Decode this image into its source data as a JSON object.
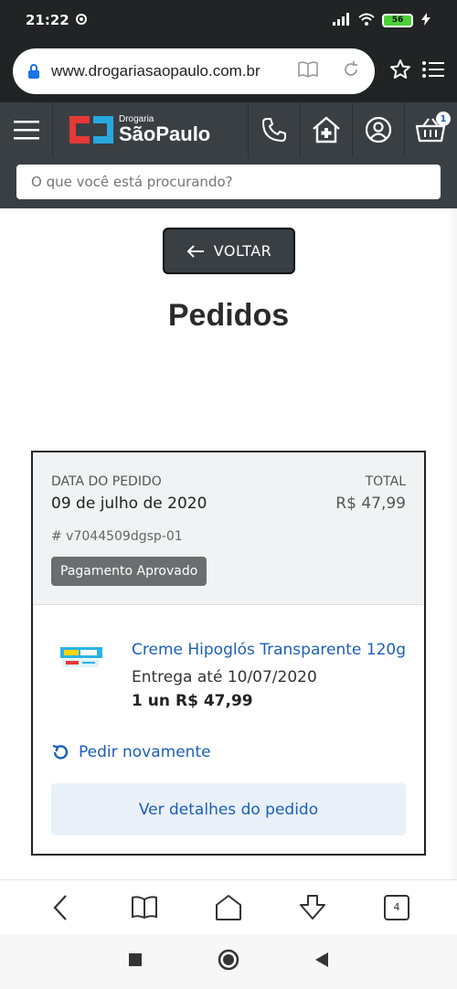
{
  "status_bar": {
    "time": "21:22",
    "battery": "56"
  },
  "browser": {
    "url": "www.drogariasaopaulo.com.br"
  },
  "site": {
    "logo_small": "Drogaria",
    "logo_big": "SãoPaulo",
    "cart_count": "1",
    "search_placeholder": "O que você está procurando?"
  },
  "page": {
    "back_label": "VOLTAR",
    "title": "Pedidos"
  },
  "order": {
    "date_label": "DATA DO PEDIDO",
    "date_value": "09 de julho de 2020",
    "total_label": "TOTAL",
    "total_value": "R$ 47,99",
    "order_id": "# v7044509dgsp-01",
    "status": "Pagamento Aprovado",
    "product_name": "Creme Hipoglós Transparente 120g",
    "delivery": "Entrega até 10/07/2020",
    "quantity": "1 un",
    "price": "R$ 47,99",
    "reorder_label": "Pedir novamente",
    "details_label": "Ver detalhes do pedido"
  },
  "toolbar": {
    "tab_count": "4"
  },
  "colors": {
    "header": "#3a3f44",
    "link": "#1b5fb8",
    "brand_red": "#e53935",
    "brand_blue": "#29a8e0"
  }
}
